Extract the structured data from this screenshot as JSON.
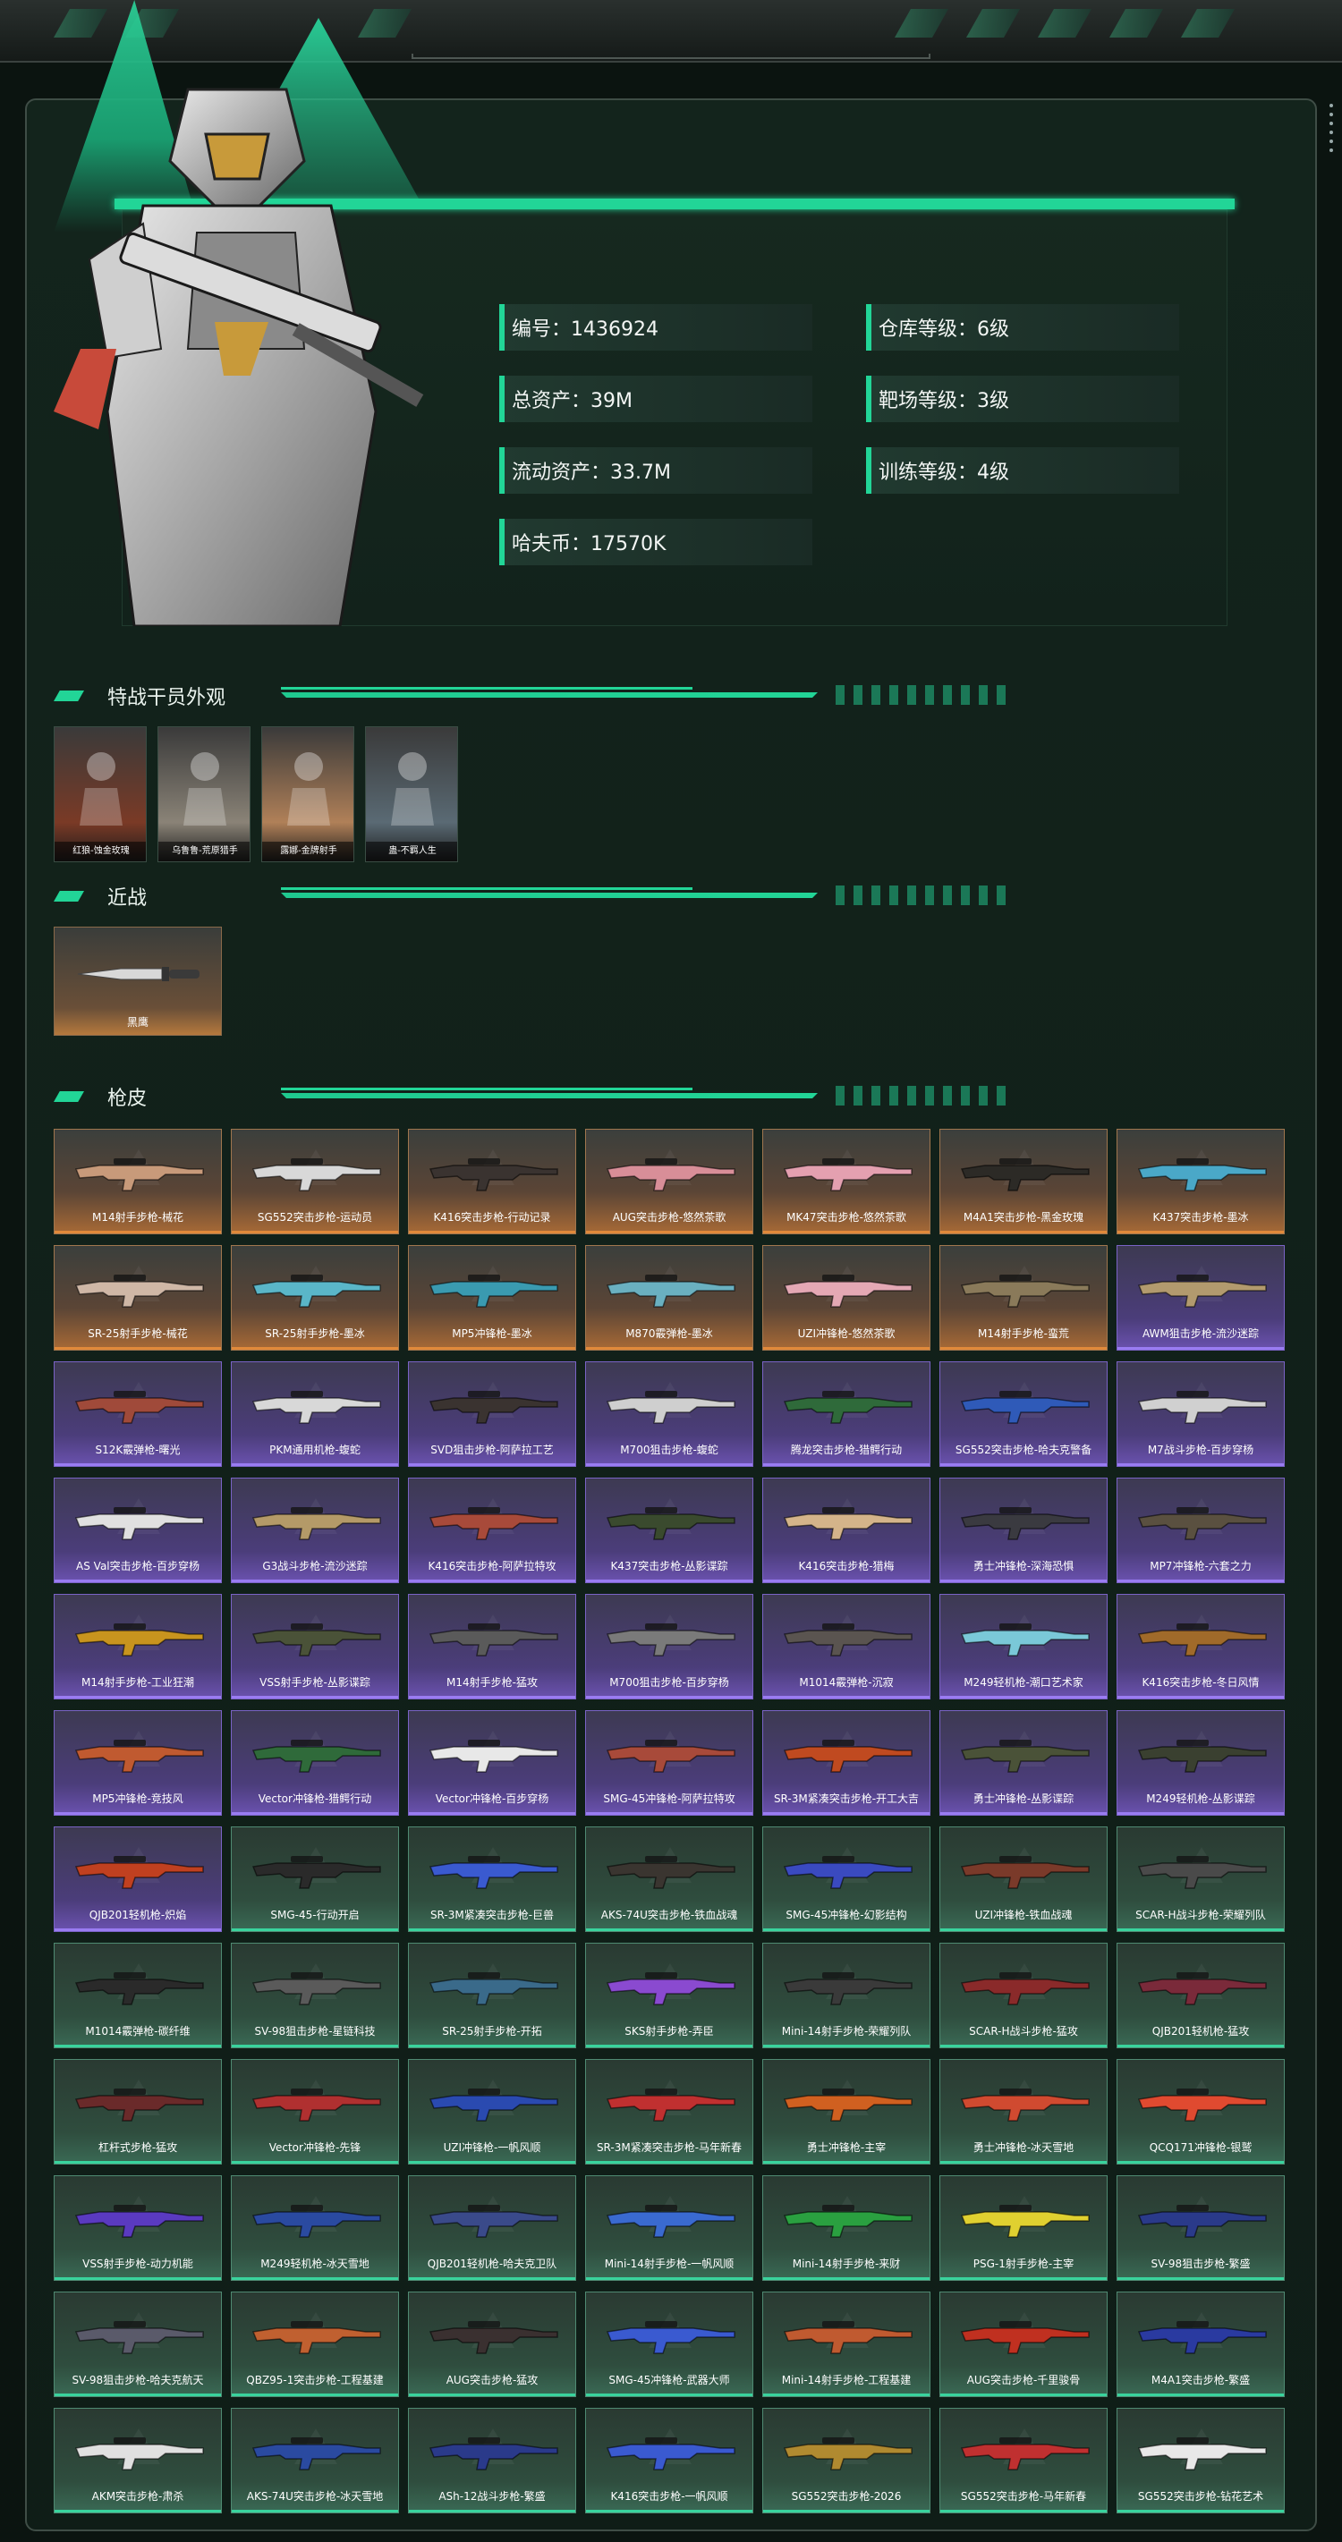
{
  "profile": {
    "id_label": "编号：1436924",
    "total_assets": "总资产：39M",
    "liquid_assets": "流动资产：33.7M",
    "hafu_coins": "哈夫币：17570K",
    "warehouse_level": "仓库等级：6级",
    "range_level": "靶场等级：3级",
    "training_level": "训练等级：4级"
  },
  "sections": {
    "operators_title": "特战干员外观",
    "melee_title": "近战",
    "skins_title": "枪皮"
  },
  "operators": [
    {
      "name": "红狼-蚀金玫瑰",
      "color": "#7a3a26"
    },
    {
      "name": "乌鲁鲁-荒原猎手",
      "color": "#8a8377"
    },
    {
      "name": "露娜-金牌射手",
      "color": "#b08058"
    },
    {
      "name": "蛊-不羁人生",
      "color": "#5a6a74"
    }
  ],
  "melee": [
    {
      "name": "黑鹰"
    }
  ],
  "skins": [
    {
      "name": "M14射手步枪-械花",
      "r": "o",
      "c": "#c89a7a"
    },
    {
      "name": "SG552突击步枪-运动员",
      "r": "o",
      "c": "#d8d8d8"
    },
    {
      "name": "K416突击步枪-行动记录",
      "r": "o",
      "c": "#3a3330"
    },
    {
      "name": "AUG突击步枪-悠然茶歌",
      "r": "o",
      "c": "#d88e98"
    },
    {
      "name": "MK47突击步枪-悠然茶歌",
      "r": "o",
      "c": "#e4a0b0"
    },
    {
      "name": "M4A1突击步枪-黑金玫瑰",
      "r": "o",
      "c": "#2c2a26"
    },
    {
      "name": "K437突击步枪-墨冰",
      "r": "o",
      "c": "#4aa8c8"
    },
    {
      "name": "SR-25射手步枪-械花",
      "r": "o",
      "c": "#cfb7a6"
    },
    {
      "name": "SR-25射手步枪-墨冰",
      "r": "o",
      "c": "#5ab6c8"
    },
    {
      "name": "MP5冲锋枪-墨冰",
      "r": "o",
      "c": "#3a9ab0"
    },
    {
      "name": "M870霰弹枪-墨冰",
      "r": "o",
      "c": "#6ab0c0"
    },
    {
      "name": "UZI冲锋枪-悠然茶歌",
      "r": "o",
      "c": "#e4a8b4"
    },
    {
      "name": "M14射手步枪-蛮荒",
      "r": "o",
      "c": "#8a7a5a"
    },
    {
      "name": "AWM狙击步枪-流沙迷踪",
      "r": "p",
      "c": "#b29a6e"
    },
    {
      "name": "S12K霰弹枪-曙光",
      "r": "p",
      "c": "#a04a3a"
    },
    {
      "name": "PKM通用机枪-蝮蛇",
      "r": "p",
      "c": "#d8d8d8"
    },
    {
      "name": "SVD狙击步枪-阿萨拉工艺",
      "r": "p",
      "c": "#3a3330"
    },
    {
      "name": "M700狙击步枪-蝮蛇",
      "r": "p",
      "c": "#cfcfcf"
    },
    {
      "name": "腾龙突击步枪-猎鳄行动",
      "r": "p",
      "c": "#2f6a3a"
    },
    {
      "name": "SG552突击步枪-哈夫克警备",
      "r": "p",
      "c": "#2f5ab8"
    },
    {
      "name": "M7战斗步枪-百步穿杨",
      "r": "p",
      "c": "#d0d0d0"
    },
    {
      "name": "AS Val突击步枪-百步穿杨",
      "r": "p",
      "c": "#e0e0e0"
    },
    {
      "name": "G3战斗步枪-流沙迷踪",
      "r": "p",
      "c": "#b49a68"
    },
    {
      "name": "K416突击步枪-阿萨拉特攻",
      "r": "p",
      "c": "#a84a3a"
    },
    {
      "name": "K437突击步枪-丛影谍踪",
      "r": "p",
      "c": "#3a4a2e"
    },
    {
      "name": "K416突击步枪-猎梅",
      "r": "p",
      "c": "#d4b48a"
    },
    {
      "name": "勇士冲锋枪-深海恐惧",
      "r": "p",
      "c": "#3a3a40"
    },
    {
      "name": "MP7冲锋枪-六套之力",
      "r": "p",
      "c": "#5a5040"
    },
    {
      "name": "M14射手步枪-工业狂潮",
      "r": "p",
      "c": "#c8941e"
    },
    {
      "name": "VSS射手步枪-丛影谍踪",
      "r": "p",
      "c": "#4a5238"
    },
    {
      "name": "M14射手步枪-猛攻",
      "r": "p",
      "c": "#5a5a5a"
    },
    {
      "name": "M700狙击步枪-百步穿杨",
      "r": "p",
      "c": "#7a7a7a"
    },
    {
      "name": "M1014霰弹枪-沉寂",
      "r": "p",
      "c": "#5a5450"
    },
    {
      "name": "M249轻机枪-潮口艺术家",
      "r": "p",
      "c": "#7ac8d8"
    },
    {
      "name": "K416突击步枪-冬日风情",
      "r": "p",
      "c": "#a06a2a"
    },
    {
      "name": "MP5冲锋枪-竞技风",
      "r": "p",
      "c": "#c05a30"
    },
    {
      "name": "Vector冲锋枪-猎鳄行动",
      "r": "p",
      "c": "#2f6a3a"
    },
    {
      "name": "Vector冲锋枪-百步穿杨",
      "r": "p",
      "c": "#e8e8e8"
    },
    {
      "name": "SMG-45冲锋枪-阿萨拉特攻",
      "r": "p",
      "c": "#a84a3a"
    },
    {
      "name": "SR-3M紧凑突击步枪-开工大吉",
      "r": "p",
      "c": "#c04a20"
    },
    {
      "name": "勇士冲锋枪-丛影谍踪",
      "r": "p",
      "c": "#4a5238"
    },
    {
      "name": "M249轻机枪-丛影谍踪",
      "r": "p",
      "c": "#3a4030"
    },
    {
      "name": "QJB201轻机枪-炽焰",
      "r": "p",
      "c": "#c04020"
    },
    {
      "name": "SMG-45-行动开启",
      "r": "g",
      "c": "#2a2a2a"
    },
    {
      "name": "SR-3M紧凑突击步枪-巨兽",
      "r": "g",
      "c": "#3a5ad0"
    },
    {
      "name": "AKS-74U突击步枪-铁血战魂",
      "r": "g",
      "c": "#3a3530"
    },
    {
      "name": "SMG-45冲锋枪-幻影结构",
      "r": "g",
      "c": "#3a4ac0"
    },
    {
      "name": "UZI冲锋枪-铁血战魂",
      "r": "g",
      "c": "#7a3a2a"
    },
    {
      "name": "SCAR-H战斗步枪-荣耀列队",
      "r": "g",
      "c": "#4a4a4a"
    },
    {
      "name": "M1014霰弹枪-碳纤维",
      "r": "g",
      "c": "#2a2a2a"
    },
    {
      "name": "SV-98狙击步枪-星链科技",
      "r": "g",
      "c": "#5a5a5a"
    },
    {
      "name": "SR-25射手步枪-开拓",
      "r": "g",
      "c": "#3a6a8a"
    },
    {
      "name": "SKS射手步枪-弄臣",
      "r": "g",
      "c": "#8a4ad0"
    },
    {
      "name": "Mini-14射手步枪-荣耀列队",
      "r": "g",
      "c": "#3a3a3a"
    },
    {
      "name": "SCAR-H战斗步枪-猛攻",
      "r": "g",
      "c": "#8a2a2a"
    },
    {
      "name": "QJB201轻机枪-猛攻",
      "r": "g",
      "c": "#7a2a3a"
    },
    {
      "name": "杠杆式步枪-猛攻",
      "r": "g",
      "c": "#6a2a2a"
    },
    {
      "name": "Vector冲锋枪-先锋",
      "r": "g",
      "c": "#b03030"
    },
    {
      "name": "UZI冲锋枪-一帆风顺",
      "r": "g",
      "c": "#2a4ab0"
    },
    {
      "name": "SR-3M紧凑突击步枪-马年新春",
      "r": "g",
      "c": "#c03030"
    },
    {
      "name": "勇士冲锋枪-主宰",
      "r": "g",
      "c": "#d06020"
    },
    {
      "name": "勇士冲锋枪-冰天雪地",
      "r": "g",
      "c": "#d04a30"
    },
    {
      "name": "QCQ171冲锋枪-银鹫",
      "r": "g",
      "c": "#e04a30"
    },
    {
      "name": "VSS射手步枪-动力机能",
      "r": "g",
      "c": "#5a3ac0"
    },
    {
      "name": "M249轻机枪-冰天雪地",
      "r": "g",
      "c": "#2a4aa0"
    },
    {
      "name": "QJB201轻机枪-哈夫克卫队",
      "r": "g",
      "c": "#3a4a8a"
    },
    {
      "name": "Mini-14射手步枪-一帆风顺",
      "r": "g",
      "c": "#3a6ad0"
    },
    {
      "name": "Mini-14射手步枪-来财",
      "r": "g",
      "c": "#2aa040"
    },
    {
      "name": "PSG-1射手步枪-主宰",
      "r": "g",
      "c": "#e0d030"
    },
    {
      "name": "SV-98狙击步枪-繁盛",
      "r": "g",
      "c": "#2a3a8a"
    },
    {
      "name": "SV-98狙击步枪-哈夫克航天",
      "r": "g",
      "c": "#5a5a6a"
    },
    {
      "name": "QBZ95-1突击步枪-工程基建",
      "r": "g",
      "c": "#c06030"
    },
    {
      "name": "AUG突击步枪-猛攻",
      "r": "g",
      "c": "#3a3030"
    },
    {
      "name": "SMG-45冲锋枪-武器大师",
      "r": "g",
      "c": "#3a5ad0"
    },
    {
      "name": "Mini-14射手步枪-工程基建",
      "r": "g",
      "c": "#c05a30"
    },
    {
      "name": "AUG突击步枪-千里骏骨",
      "r": "g",
      "c": "#c03020"
    },
    {
      "name": "M4A1突击步枪-繁盛",
      "r": "g",
      "c": "#2a3aa0"
    },
    {
      "name": "AKM突击步枪-肃杀",
      "r": "g",
      "c": "#e0e0e0"
    },
    {
      "name": "AKS-74U突击步枪-冰天雪地",
      "r": "g",
      "c": "#2a4aa0"
    },
    {
      "name": "ASh-12战斗步枪-繁盛",
      "r": "g",
      "c": "#2a3a8a"
    },
    {
      "name": "K416突击步枪-一帆风顺",
      "r": "g",
      "c": "#3a5ad0"
    },
    {
      "name": "SG552突击步枪-2026",
      "r": "g",
      "c": "#b08a30"
    },
    {
      "name": "SG552突击步枪-马年新春",
      "r": "g",
      "c": "#c03030"
    },
    {
      "name": "SG552突击步枪-钻花艺术",
      "r": "g",
      "c": "#e8e8e8"
    }
  ]
}
